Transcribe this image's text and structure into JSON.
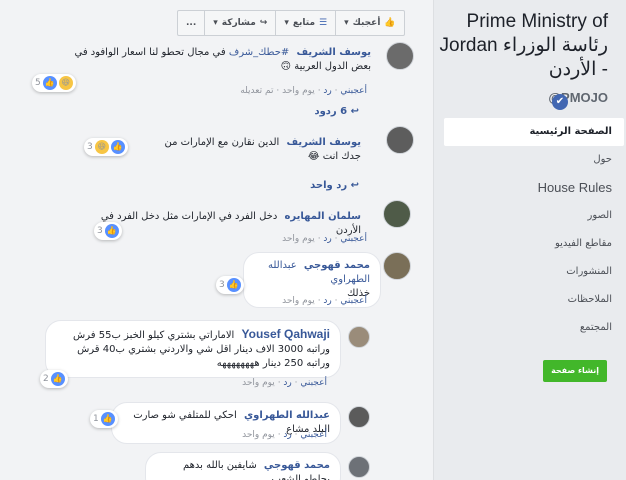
{
  "page": {
    "title": "Prime Ministry of Jordan رئاسة الوزراء - الأردن",
    "handle": "@PMOJO",
    "nav": [
      {
        "label": "الصفحة الرئيسية",
        "active": true
      },
      {
        "label": "حول"
      },
      {
        "label": "House Rules"
      },
      {
        "label": "الصور"
      },
      {
        "label": "مقاطع الفيديو"
      },
      {
        "label": "المنشورات"
      },
      {
        "label": "الملاحظات"
      },
      {
        "label": "المجتمع"
      }
    ],
    "create_page": "إنشاء صفحة"
  },
  "actions": {
    "like": "أعجبك",
    "follow": "متابع",
    "share": "مشاركة",
    "more": "..."
  },
  "comments": [
    {
      "author": "يوسف الشريف",
      "mention": "#حطك_شرف",
      "text": "في مجال تحطو لنا اسعار الوافود في بعض الدول العربية 🙃",
      "meta": {
        "like": "أعجبني",
        "reply": "رد",
        "time": "يوم واحد",
        "edited": "تم تعديله"
      },
      "reactions": "5"
    },
    {
      "replies": "6 ردود"
    },
    {
      "author": "يوسف الشريف",
      "text": "الدين نقارن مع الإمارات من جدك انت 😂",
      "reactions": "3"
    },
    {
      "replies": "رد واحد"
    },
    {
      "author": "سلمان المهايره",
      "text": "دخل الفرد في الإمارات مثل دخل الفرد في الأردن",
      "meta": {
        "like": "أعجبني",
        "reply": "رد",
        "time": "يوم واحد"
      },
      "reactions": "3"
    },
    {
      "author": "محمد قهوجي",
      "mention": "عبدالله الطهراوي",
      "text": "خذلك",
      "meta": {
        "like": "أعجبني",
        "reply": "رد",
        "time": "يوم واحد"
      },
      "reactions": "3"
    },
    {
      "author": "Yousef Qahwaji",
      "text": "الاماراتي بشتري كيلو الخبز ب55 فرش وراتبه 3000 الاف دينار اقل شي والاردني بشتري ب40 قرش وراتبه 250 دينار ههههههههه",
      "meta": {
        "like": "أعجبني",
        "reply": "رد",
        "time": "يوم واحد"
      },
      "reactions": "2"
    },
    {
      "author": "عبدالله الطهراوي",
      "text": "احكي للمتلفي شو صارت البلد مشاع",
      "meta": {
        "like": "أعجبني",
        "reply": "رد",
        "time": "يوم واحد"
      },
      "reactions": "1"
    },
    {
      "author": "محمد قهوجي",
      "text": "شايفين بالله بدهم يجلطو الشعب"
    }
  ]
}
